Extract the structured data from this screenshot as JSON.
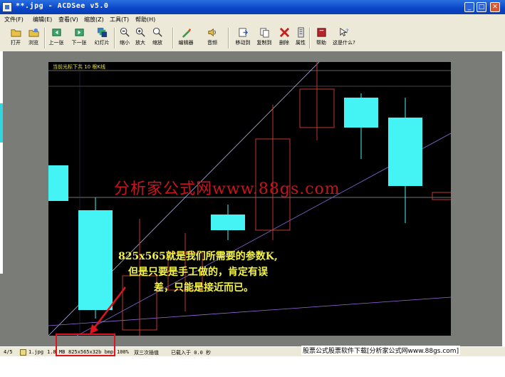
{
  "window": {
    "title": "**.jpg - ACDSee v5.0",
    "controls": {
      "minimize": "_",
      "maximize": "□",
      "close": "✕"
    }
  },
  "menu": {
    "items": [
      "文件(F)",
      "编辑(E)",
      "查看(V)",
      "缩放(Z)",
      "工具(T)",
      "帮助(H)"
    ]
  },
  "toolbar": {
    "buttons": [
      {
        "label": "打开",
        "icon": "open-folder-icon"
      },
      {
        "label": "浏览",
        "icon": "browse-icon"
      },
      {
        "label": "上一张",
        "icon": "previous-image-icon"
      },
      {
        "label": "下一张",
        "icon": "next-image-icon"
      },
      {
        "label": "幻灯片",
        "icon": "slideshow-icon"
      },
      {
        "label": "缩小",
        "icon": "zoom-out-icon"
      },
      {
        "label": "放大",
        "icon": "zoom-in-icon"
      },
      {
        "label": "缩放",
        "icon": "zoom-icon"
      },
      {
        "label": "编辑器",
        "icon": "editor-icon"
      },
      {
        "label": "音频",
        "icon": "audio-icon"
      },
      {
        "label": "移动到",
        "icon": "move-to-icon"
      },
      {
        "label": "复制到",
        "icon": "copy-to-icon"
      },
      {
        "label": "删除",
        "icon": "delete-icon"
      },
      {
        "label": "属性",
        "icon": "properties-icon"
      },
      {
        "label": "帮助",
        "icon": "help-book-icon"
      },
      {
        "label": "这是什么?",
        "icon": "whats-this-icon"
      }
    ]
  },
  "image": {
    "chart_label": "当前光标下共 10 根K线",
    "watermark": "分析家公式网www.88gs.com",
    "note_lines": [
      "825x565就是我们所需要的参数K,",
      "但是只要是手工做的，肯定有误",
      "差，只能是接近而已。"
    ]
  },
  "status": {
    "index": "4/5",
    "filename": "1.jpg",
    "filesize": "1.8 MB",
    "resolution": "825x565x32b bmp",
    "zoom": "100%",
    "filter": "双三次插值",
    "load_time": "已载入于 0.0 秒"
  },
  "footer": {
    "text": "股票公式股票软件下载[分析家公式网www.88gs.com]"
  },
  "colors": {
    "candle_up": "#44f4f4",
    "candle_down": "#c0392b",
    "annotation_red": "#e0141e",
    "note_yellow": "#f2f24a"
  }
}
